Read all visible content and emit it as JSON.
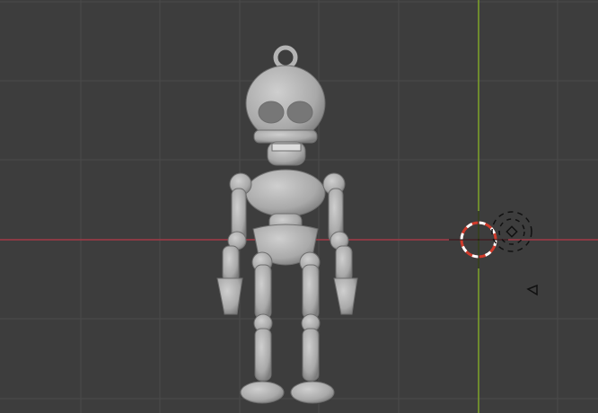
{
  "viewport": {
    "background": "#3d3d3d",
    "grid_color": "#4b4b4b",
    "x_axis_color": "#a33a46",
    "y_axis_color": "#7fa32a"
  },
  "scene": {
    "object": "skeleton-keychain-model",
    "model_color": "#b4b4b4",
    "cursor_colors": [
      "#d23b2b",
      "#ffffff"
    ],
    "light_icon": "light-icon",
    "camera_icon": "camera-icon"
  }
}
